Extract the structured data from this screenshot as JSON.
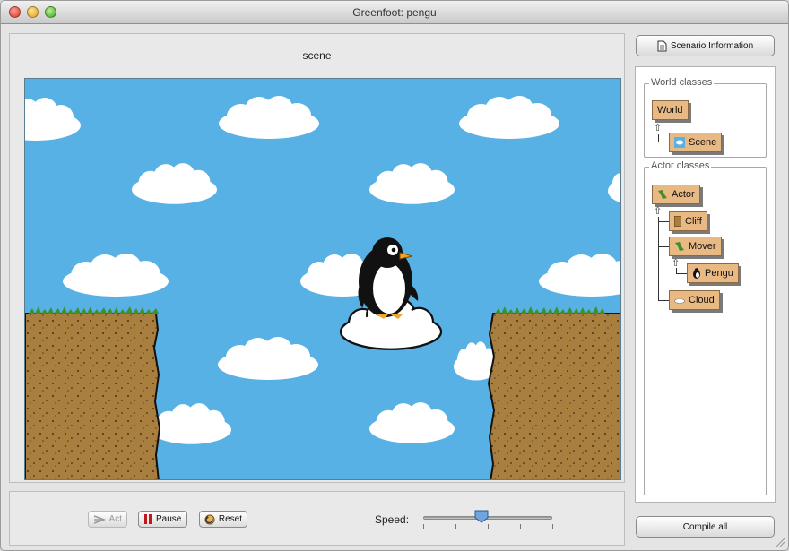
{
  "window": {
    "title": "Greenfoot: pengu"
  },
  "scene": {
    "label": "scene"
  },
  "controls": {
    "act_label": "Act",
    "pause_label": "Pause",
    "reset_label": "Reset",
    "speed_label": "Speed:",
    "speed_level": 0.45
  },
  "sidebar": {
    "scenario_info_label": "Scenario Information",
    "compile_all_label": "Compile all",
    "world_classes": {
      "title": "World classes",
      "items": [
        "World",
        "Scene"
      ]
    },
    "actor_classes": {
      "title": "Actor classes",
      "items": [
        "Actor",
        "Cliff",
        "Mover",
        "Pengu",
        "Cloud"
      ]
    }
  },
  "colors": {
    "sky": "#58b1e5",
    "class_box": "#e9b983",
    "cliff": "#a97f3f",
    "grass": "#3f8f2a"
  }
}
